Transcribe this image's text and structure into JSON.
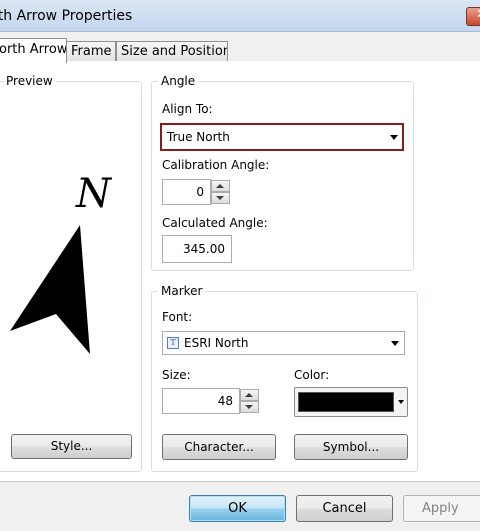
{
  "window": {
    "title": "rth Arrow Properties"
  },
  "tabs": [
    {
      "label": "orth Arrow"
    },
    {
      "label": "Frame"
    },
    {
      "label": "Size and Position"
    }
  ],
  "preview": {
    "group_title": "Preview",
    "glyph": "N",
    "style_button": "Style..."
  },
  "angle": {
    "group_title": "Angle",
    "align_to_label": "Align To:",
    "align_to_value": "True North",
    "calibration_label": "Calibration Angle:",
    "calibration_value": "0",
    "calculated_label": "Calculated Angle:",
    "calculated_value": "345.00"
  },
  "marker": {
    "group_title": "Marker",
    "font_label": "Font:",
    "font_value": "ESRI North",
    "font_icon_text": "T",
    "size_label": "Size:",
    "size_value": "48",
    "color_label": "Color:",
    "color_value": "#000000",
    "character_button": "Character...",
    "symbol_button": "Symbol..."
  },
  "footer": {
    "ok": "OK",
    "cancel": "Cancel",
    "apply": "Apply"
  },
  "colors": {
    "highlight_border": "#8b1a1a",
    "arrow_fill": "#000000"
  }
}
